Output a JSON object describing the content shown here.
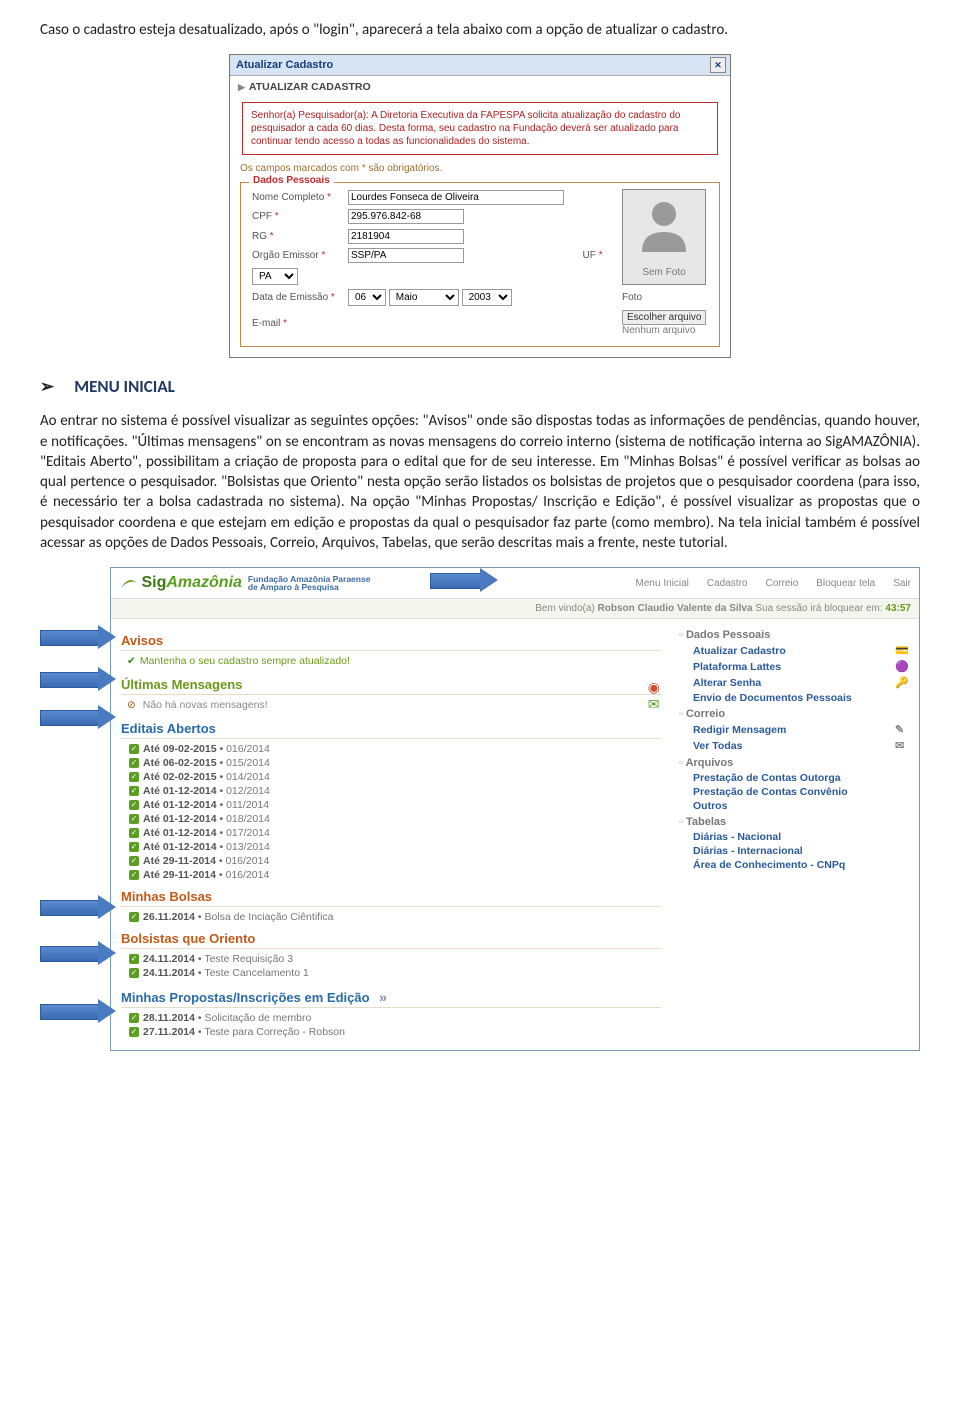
{
  "doc": {
    "para1": "Caso o cadastro esteja desatualizado, após o \"login\", aparecerá a tela abaixo com a opção de atualizar o cadastro.",
    "menu_heading": "MENU INICIAL",
    "para2": "Ao entrar no sistema é possível visualizar as seguintes opções: \"Avisos\" onde são dispostas todas as informações de pendências, quando houver, e notificações. \"Últimas mensagens\" on se encontram as novas mensagens do correio interno (sistema de notificação interna ao SigAMAZÔNIA). \"Editais Aberto\", possibilitam a criação de proposta para o edital que for de seu interesse. Em \"Minhas Bolsas\" é possível verificar as bolsas ao qual pertence o pesquisador. \"Bolsistas que Oriento\" nesta opção serão listados os bolsistas de projetos que o pesquisador coordena (para isso, é necessário ter a bolsa cadastrada no sistema). Na opção \"Minhas Propostas/ Inscrição e Edição\", é possível visualizar as propostas que o pesquisador coordena e que estejam em edição e propostas da qual o pesquisador faz parte (como membro). Na tela inicial também é possível acessar as opções de Dados Pessoais, Correio, Arquivos, Tabelas, que serão descritas mais a frente, neste tutorial."
  },
  "inset1": {
    "title": "Atualizar Cadastro",
    "sub": "ATUALIZAR CADASTRO",
    "warning": "Senhor(a) Pesquisador(a): A Diretoria Executiva da FAPESPA solicita atualização do cadastro do pesquisador a cada 60 dias. Desta forma, seu cadastro na Fundação deverá ser atualizado para continuar tendo acesso a todas as funcionalidades do sistema.",
    "note": "Os campos marcados com * são obrigatórios.",
    "legend": "Dados Pessoais",
    "labels": {
      "nome": "Nome Completo",
      "cpf": "CPF",
      "rg": "RG",
      "orgao": "Orgão Emissor",
      "uf": "UF",
      "data": "Data de Emissão",
      "email": "E-mail",
      "foto": "Foto",
      "escolher": "Escolher arquivo",
      "nenhum": "Nenhum arquivo"
    },
    "values": {
      "nome": "Lourdes Fonseca de Oliveira",
      "cpf": "295.976.842-68",
      "rg": "2181904",
      "orgao": "SSP/PA",
      "uf_sel": "PA",
      "dia": "06",
      "mes": "Maio",
      "ano": "2003",
      "semfoto": "Sem Foto"
    }
  },
  "inset2": {
    "brand_sig": "Sig",
    "brand_ama": "Amazônia",
    "brand_sub1": "Fundação Amazônia Paraense",
    "brand_sub2": "de Amparo à Pesquisa",
    "menu": [
      "Menu Inicial",
      "Cadastro",
      "Correio",
      "Bloquear tela",
      "Sair"
    ],
    "session_prefix": "Bem vindo(a) ",
    "session_user": "Robson Claudio Valente da Silva",
    "session_mid": "    Sua sessão irá bloquear em: ",
    "session_time": "43:57",
    "sec_avisos": "Avisos",
    "aviso_line": "Mantenha o seu cadastro sempre atualizado!",
    "sec_ultimas": "Últimas Mensagens",
    "no_msgs_prefix": "✕",
    "no_msgs": "Não há novas mensagens!",
    "sec_editais": "Editais Abertos",
    "editais": [
      {
        "d": "Até 09-02-2015",
        "e": "016/2014"
      },
      {
        "d": "Até 06-02-2015",
        "e": "015/2014"
      },
      {
        "d": "Até 02-02-2015",
        "e": "014/2014"
      },
      {
        "d": "Até 01-12-2014",
        "e": "012/2014"
      },
      {
        "d": "Até 01-12-2014",
        "e": "011/2014"
      },
      {
        "d": "Até 01-12-2014",
        "e": "018/2014"
      },
      {
        "d": "Até 01-12-2014",
        "e": "017/2014"
      },
      {
        "d": "Até 01-12-2014",
        "e": "013/2014"
      },
      {
        "d": "Até 29-11-2014",
        "e": "016/2014"
      },
      {
        "d": "Até 29-11-2014",
        "e": "016/2014"
      }
    ],
    "sec_bolsas": "Minhas Bolsas",
    "bolsas": [
      {
        "d": "26.11.2014",
        "t": "Bolsa de Inciação Ciêntifica"
      }
    ],
    "sec_oriento": "Bolsistas que Oriento",
    "oriento": [
      {
        "d": "24.11.2014",
        "t": "Teste Requisição 3"
      },
      {
        "d": "24.11.2014",
        "t": "Teste Cancelamento 1"
      }
    ],
    "sec_propostas": "Minhas Propostas/Inscrições em Edição",
    "propostas": [
      {
        "d": "28.11.2014",
        "t": "Solicitação de membro"
      },
      {
        "d": "27.11.2014",
        "t": "Teste para Correção - Robson"
      }
    ],
    "more": "»",
    "right": {
      "h_dados": "Dados Pessoais",
      "l_atualizar": "Atualizar Cadastro",
      "l_lattes": "Plataforma Lattes",
      "l_senha": "Alterar Senha",
      "l_envio": "Envio de Documentos Pessoais",
      "h_correio": "Correio",
      "l_redigir": "Redigir Mensagem",
      "l_todas": "Ver Todas",
      "h_arquivos": "Arquivos",
      "l_pco": "Prestação de Contas Outorga",
      "l_pcc": "Prestação de Contas Convênio",
      "l_outros": "Outros",
      "h_tabelas": "Tabelas",
      "l_dn": "Diárias - Nacional",
      "l_di": "Diárias - Internacional",
      "l_cnpq": "Área de Conhecimento - CNPq"
    }
  }
}
